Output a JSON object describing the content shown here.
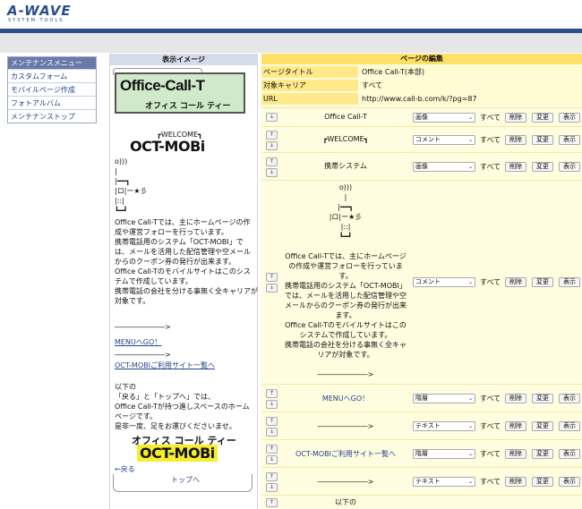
{
  "header": {
    "logo": "A-WAVE",
    "logo_sub": "SYSTEM TOOLS"
  },
  "menu": {
    "title": "メンテナンスメニュー",
    "items": [
      "カスタムフォーム",
      "モバイルページ作成",
      "フォトアルバム",
      "メンテナンストップ"
    ]
  },
  "preview": {
    "title": "表示イメージ",
    "banner_title": "Office-Call-T",
    "banner_sub": "オフィス コール ティー",
    "welcome": "┏WELCOME┓",
    "oct_mobi": "OCT-MOBi",
    "art": [
      "o)))",
      "|",
      "|━━┓",
      "|ロ|ー★彡",
      "|::|",
      "┗━┛"
    ],
    "body": [
      "Office Call-Tでは、主にホームページの作",
      "成や運営フォローを行っています。",
      "携帯電話用のシステム「OCT-MOBI」で",
      "は、メールを活用した配信管理や空メール",
      "からのクーポン券の発行が出来ます。",
      "Office Call-Tのモバイルサイトはこのシス",
      "テムで作成しています。",
      "携帯電話の会社を分ける事無く全キャリアが",
      "対象です。"
    ],
    "arrow_line": "―――――――>",
    "link_menu": "MENUへGO！",
    "link_sites": "OCT-MOBIご利用サイト一覧へ",
    "footer": [
      "以下の",
      "「戻る」と「トップへ」では、",
      "Office Call-Tが持つ進しスペースのホーム",
      "ページです。",
      "是非一度、足をお運びくださいませ。"
    ],
    "footer_logo": "オフィス コール ティー",
    "footer_mobi": "OCT-MOBi",
    "back": "←戻る",
    "top": "トップへ"
  },
  "editor": {
    "title": "ページの編集",
    "info": [
      {
        "label": "ページタイトル",
        "value": "Office Call-T(本部)"
      },
      {
        "label": "対象キャリア",
        "value": "すべて"
      },
      {
        "label": "URL",
        "value": "http://www.call-b.com/k/?pg=87"
      }
    ],
    "all_label": "すべて",
    "btn_delete": "削除",
    "btn_change": "変更",
    "btn_show": "表示",
    "rows": [
      {
        "content": "Office Call-T",
        "type": "画像"
      },
      {
        "content": "┏WELCOME┓",
        "type": "コメント"
      },
      {
        "content": "携帯システム",
        "type": "画像"
      },
      {
        "content": "o)))\n|\n|━━┓\n|ロ|ー★彡\n|::|\n┗━┛\n\nOffice Call-Tでは、主にホームページ\nの作成や運営フォローを行っていま\nす。\n携帯電話用のシステム「OCT-MOBI」\nでは、メールを活用した配信管理や空\nメールからのクーポン券の発行が出来\nます。\nOffice Call-Tのモバイルサイトはこの\nシステムで作成しています。\n携帯電話の会社を分ける事無く全キャ\nリアが対象です。\n\n―――――――>",
        "type": "コメント"
      },
      {
        "content": "MENUへGO！",
        "type": "階層"
      },
      {
        "content": "―――――――>",
        "type": "テキスト"
      },
      {
        "content": "OCT-MOBIご利用サイト一覧へ",
        "type": "階層"
      },
      {
        "content": "―――――――>",
        "type": "テキスト"
      },
      {
        "content": "以下の",
        "type": ""
      }
    ]
  }
}
